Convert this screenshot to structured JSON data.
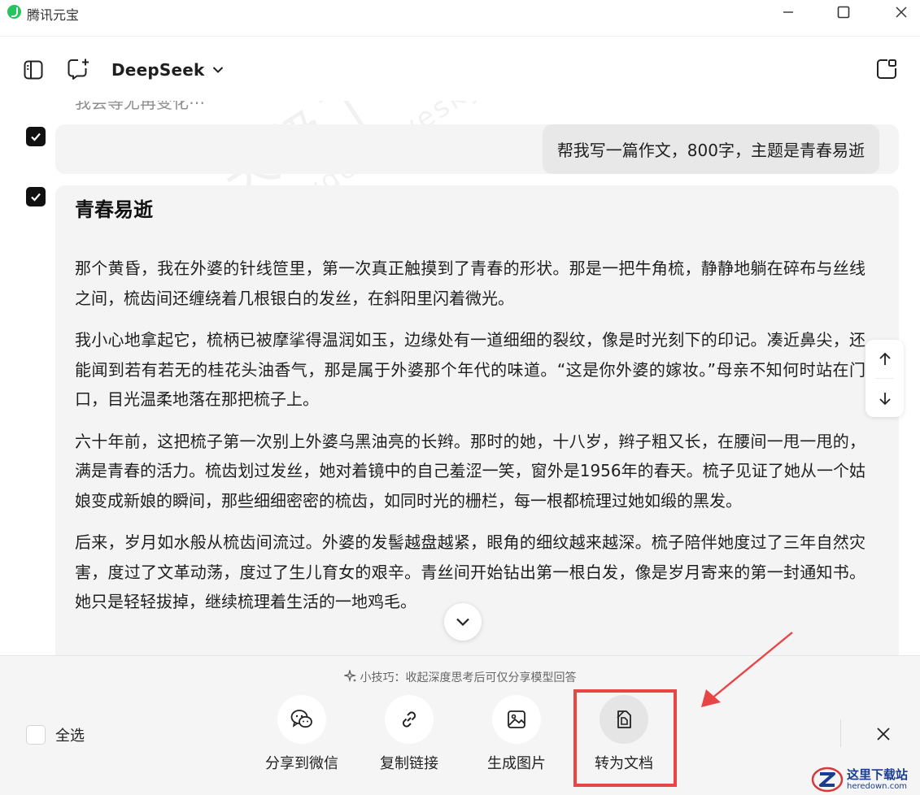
{
  "window": {
    "title": "腾讯元宝"
  },
  "header": {
    "model_name": "DeepSeek"
  },
  "chat": {
    "partial_line": "我会等尤再变化⋯",
    "user_message": "帮我写一篇作文，800字，主题是青春易逝",
    "answer": {
      "title": "青春易逝",
      "paragraphs": [
        "那个黄昏，我在外婆的针线笸里，第一次真正触摸到了青春的形状。那是一把牛角梳，静静地躺在碎布与丝线之间，梳齿间还缠绕着几根银白的发丝，在斜阳里闪着微光。",
        "我小心地拿起它，梳柄已被摩挲得温润如玉，边缘处有一道细细的裂纹，像是时光刻下的印记。凑近鼻尖，还能闻到若有若无的桂花头油香气，那是属于外婆那个年代的味道。“这是你外婆的嫁妆。”母亲不知何时站在门口，目光温柔地落在那把梳子上。",
        "六十年前，这把梳子第一次别上外婆乌黑油亮的长辫。那时的她，十八岁，辫子粗又长，在腰间一甩一甩的，满是青春的活力。梳齿划过发丝，她对着镜中的自己羞涩一笑，窗外是1956年的春天。梳子见证了她从一个姑娘变成新娘的瞬间，那些细细密密的梳齿，如同时光的栅栏，每一根都梳理过她如缎的黑发。",
        "后来，岁月如水般从梳齿间流过。外婆的发髻越盘越紧，眼角的细纹越来越深。梳子陪伴她度过了三年自然灾害，度过了文革动荡，度过了生儿育女的艰辛。青丝间开始钻出第一根白发，像是岁月寄来的第一封通知书。她只是轻轻拔掉，继续梳理着生活的一地鸡毛。"
      ]
    },
    "watermark": {
      "main": "天极下载站",
      "url": "mydown.yesky.com"
    }
  },
  "share_bar": {
    "tip": "小技巧：收起深度思考后可仅分享模型回答",
    "select_all": "全选",
    "actions": [
      {
        "label": "分享到微信",
        "icon": "wechat-icon"
      },
      {
        "label": "复制链接",
        "icon": "link-icon"
      },
      {
        "label": "生成图片",
        "icon": "image-icon"
      },
      {
        "label": "转为文档",
        "icon": "document-icon"
      }
    ]
  },
  "site_badge": {
    "name": "这里下载站",
    "url": "heredown.com"
  },
  "colors": {
    "highlight": "#e84545",
    "bubble": "#e8e8e9",
    "card": "#f4f4f5",
    "logo": "#22c55e",
    "badge": "#1a3d8f"
  }
}
